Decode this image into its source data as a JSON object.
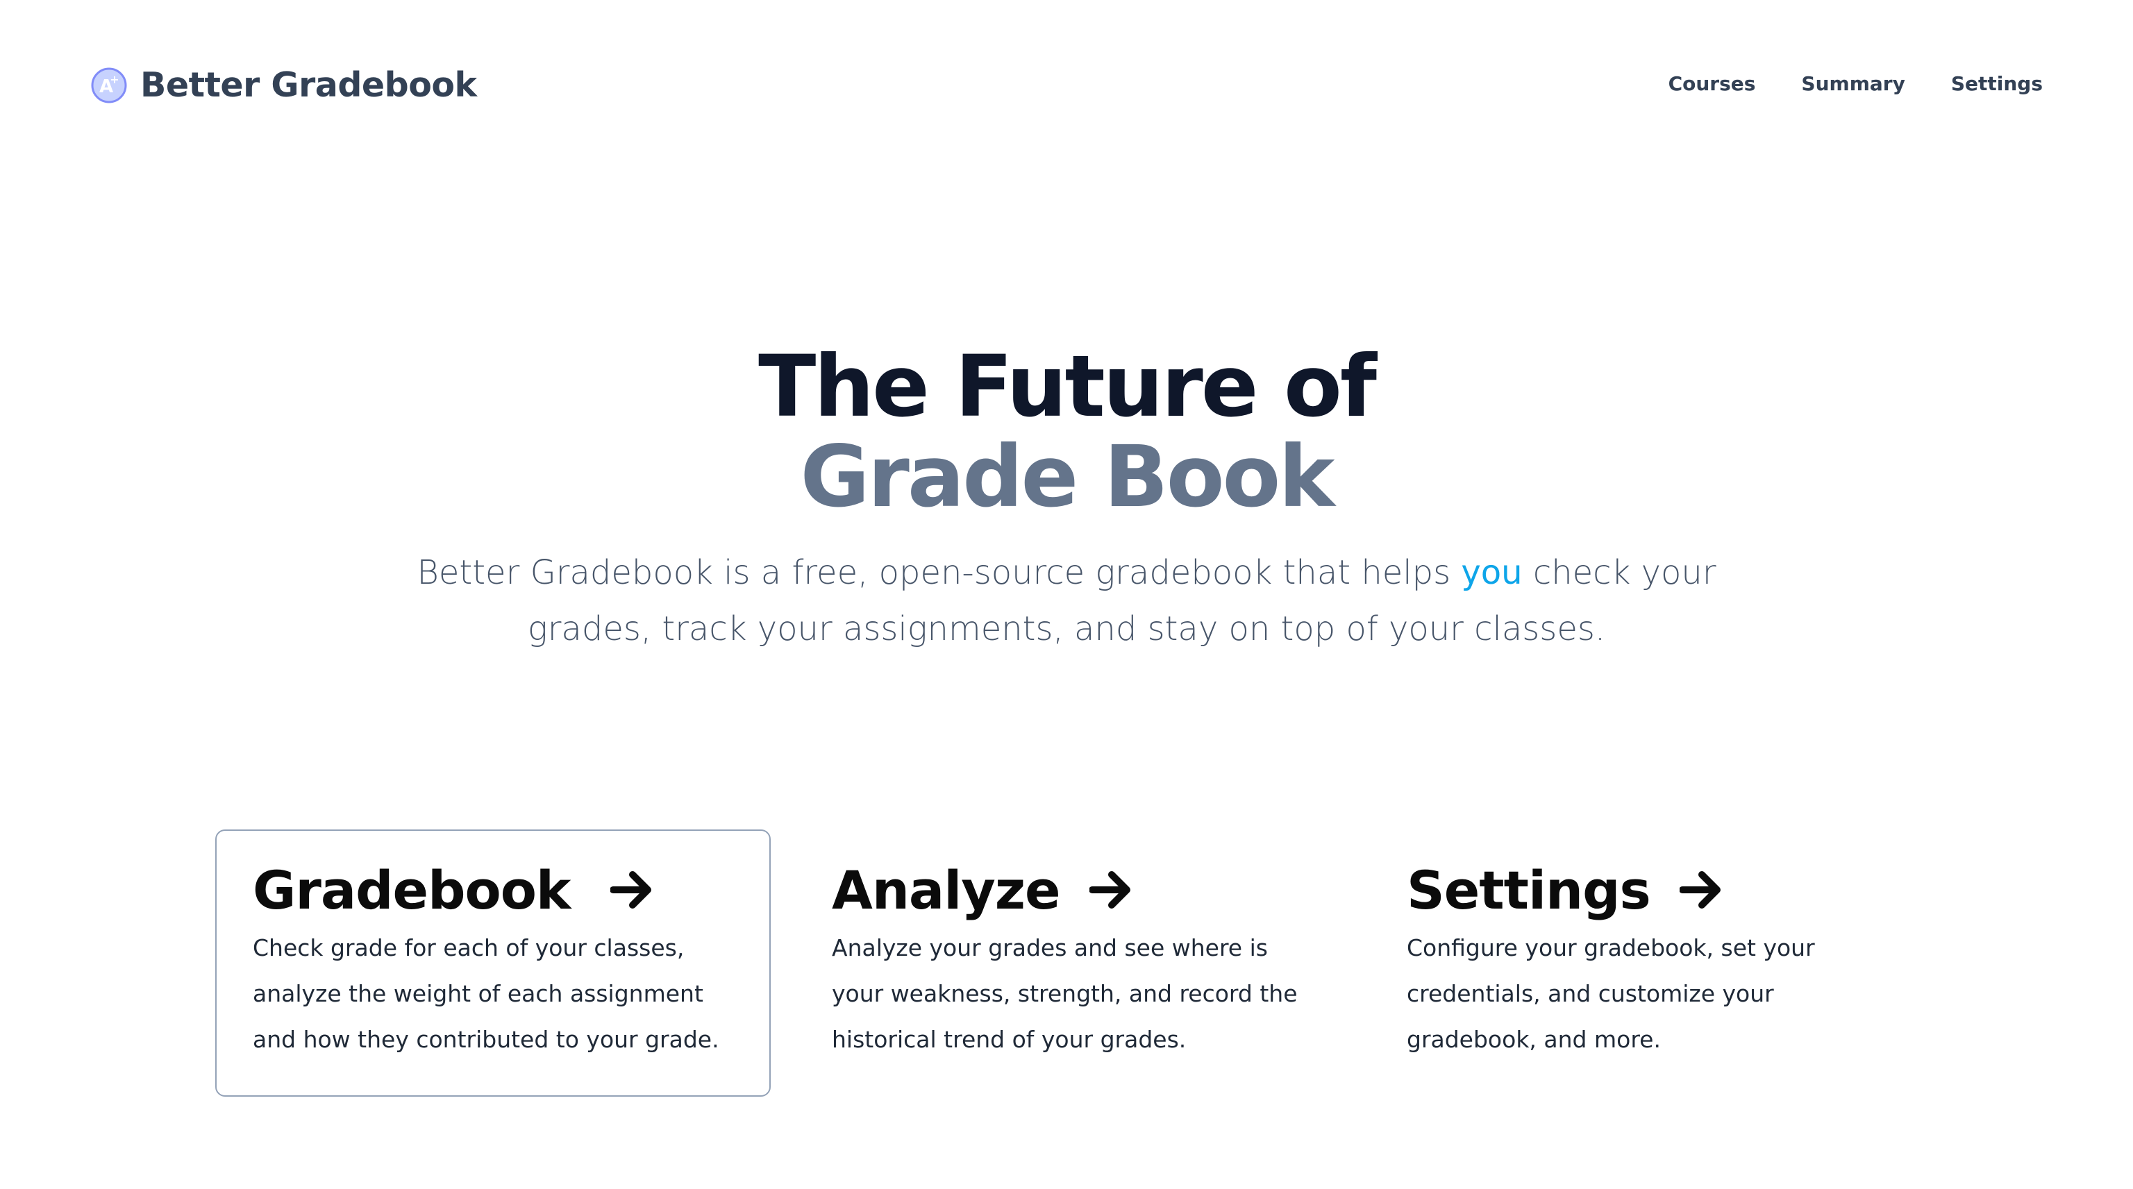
{
  "header": {
    "brand_name": "Better Gradebook",
    "logo_icon": "a-plus-circle-icon",
    "nav": [
      {
        "label": "Courses"
      },
      {
        "label": "Summary"
      },
      {
        "label": "Settings"
      }
    ]
  },
  "hero": {
    "title_line1": "The Future of",
    "title_line2": "Grade Book",
    "tagline_before": "Better Gradebook is a free, open-source gradebook that helps",
    "tagline_accent": "you",
    "tagline_after": "check your grades, track your assignments, and stay on top of your classes."
  },
  "cards": [
    {
      "title": "Gradebook",
      "description": "Check grade for each of your classes, analyze the weight of each assignment and how they contributed to your grade.",
      "icon": "arrow-right-icon"
    },
    {
      "title": "Analyze",
      "description": "Analyze your grades and see where is your weakness, strength, and record the historical trend of your grades.",
      "icon": "arrow-right-icon"
    },
    {
      "title": "Settings",
      "description": "Configure your gradebook, set your credentials, and customize your gradebook, and more.",
      "icon": "arrow-right-icon"
    }
  ],
  "colors": {
    "title_dark": "#0f172a",
    "title_muted": "#64748b",
    "accent": "#0ea5e9",
    "card_border": "#94a3b8"
  }
}
